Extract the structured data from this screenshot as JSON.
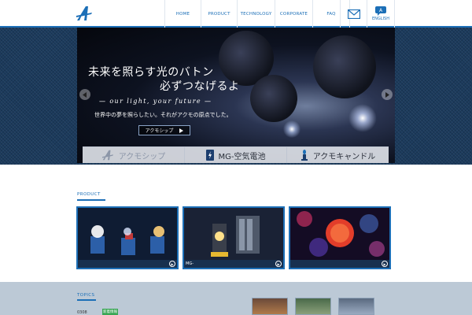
{
  "header": {
    "nav": [
      "HOME",
      "PRODUCT",
      "TECHNOLOGY",
      "CORPORATE",
      "FAQ"
    ],
    "language": "ENGLISH"
  },
  "hero": {
    "title_line1": "未来を照らす光のバトン",
    "title_line2": "必ずつなげるよ",
    "tagline": "— our light, your future —",
    "subtitle": "世界中の夢を照らしたい。それがアクモの原点でした。",
    "button_label": "アクモシップ"
  },
  "tabs": [
    {
      "label": "アクモシップ",
      "icon": "acmo-logo-icon"
    },
    {
      "label": "MG-空気電池",
      "icon": "battery-icon"
    },
    {
      "label": "アクモキャンドル",
      "icon": "candle-icon"
    }
  ],
  "product": {
    "heading": "PRODUCT",
    "cards": [
      {
        "caption": ""
      },
      {
        "caption": "MG-"
      },
      {
        "caption": ""
      }
    ]
  },
  "topics": {
    "heading": "TOPICS",
    "first_date": "0308",
    "first_badge": "新着情報"
  },
  "colors": {
    "accent": "#1c6fb7",
    "hero_band": "#1b3a5c",
    "topics_band": "#bcc9d6",
    "badge": "#3aa655"
  }
}
